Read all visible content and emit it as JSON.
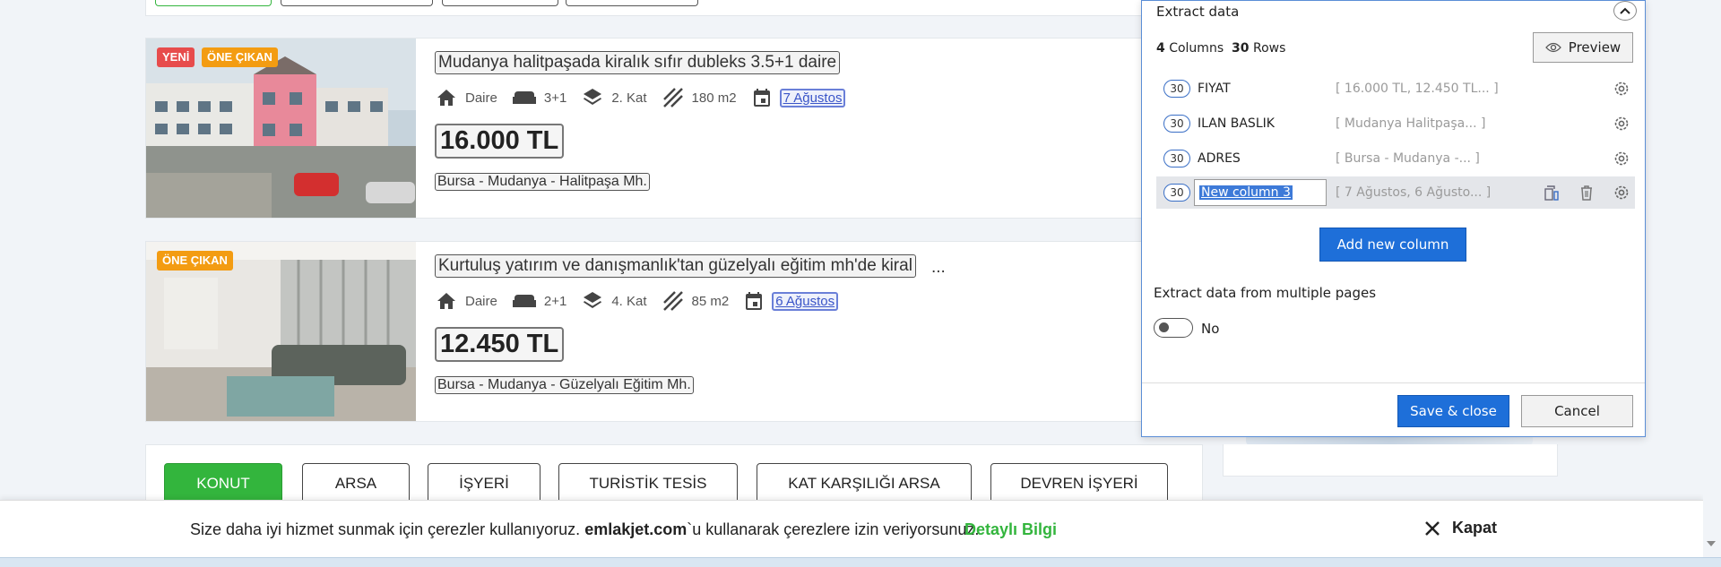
{
  "listings": [
    {
      "badges": [
        "YENİ",
        "ÖNE ÇIKAN"
      ],
      "title": "Mudanya halitpaşada kiralık sıfır dubleks 3.5+1 daire",
      "type": "Daire",
      "rooms": "3+1",
      "floor": "2. Kat",
      "area": "180 m2",
      "date": "7 Ağustos",
      "price": "16.000 TL",
      "address": "Bursa - Mudanya - Halitpaşa Mh."
    },
    {
      "badges": [
        "ÖNE ÇIKAN"
      ],
      "title": "Kurtuluş yatırım ve danışmanlık'tan güzelyalı eğitim mh'de kiral",
      "title_ellipsis": "...",
      "type": "Daire",
      "rooms": "2+1",
      "floor": "4. Kat",
      "area": "85 m2",
      "date": "6 Ağustos",
      "price": "12.450 TL",
      "address": "Bursa - Mudanya - Güzelyalı Eğitim Mh."
    }
  ],
  "categories": [
    {
      "label": "KONUT",
      "active": true
    },
    {
      "label": "ARSA",
      "active": false
    },
    {
      "label": "İŞYERİ",
      "active": false
    },
    {
      "label": "TURİSTİK TESİS",
      "active": false
    },
    {
      "label": "KAT KARŞILIĞI ARSA",
      "active": false
    },
    {
      "label": "DEVREN İŞYERİ",
      "active": false
    }
  ],
  "cookie": {
    "message_pre": "Size daha iyi hizmet sunmak için çerezler kullanıyoruz. ",
    "site": "emlakjet.com",
    "message_post": "`u kullanarak çerezlere izin veriyorsunuz.",
    "more": "Detaylı Bilgi",
    "close": "Kapat"
  },
  "extract_panel": {
    "title": "Extract data",
    "columns_count": "4",
    "columns_label": "Columns",
    "rows_count": "30",
    "rows_label": "Rows",
    "preview": "Preview",
    "columns": [
      {
        "count": "30",
        "name": "FIYAT",
        "preview": "[ 16.000 TL, 12.450 TL... ]"
      },
      {
        "count": "30",
        "name": "ILAN BASLIK",
        "preview": "[ Mudanya Halitpaşa...  ]"
      },
      {
        "count": "30",
        "name": "ADRES",
        "preview": "[ Bursa - Mudanya -...  ]"
      },
      {
        "count": "30",
        "name": "New column 3",
        "preview": "[ 7 Ağustos, 6 Ağusto... ]",
        "selected": true
      }
    ],
    "add_column": "Add new column",
    "multi_pages_label": "Extract data from multiple pages",
    "multi_pages_value": "No",
    "save": "Save & close",
    "cancel": "Cancel"
  },
  "colors": {
    "accent_blue": "#1e6fd9",
    "active_green": "#33b53d",
    "badge_red": "#e74c4c",
    "badge_orange": "#f39c12"
  }
}
